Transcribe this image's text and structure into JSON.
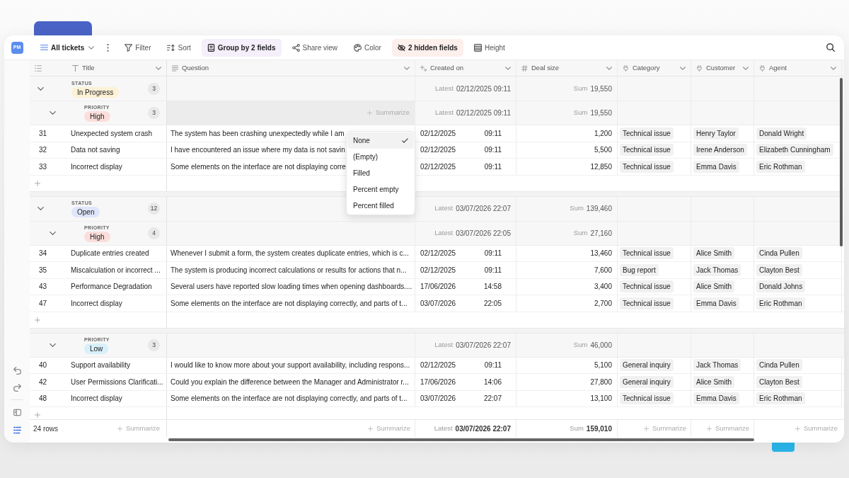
{
  "sidebar": {
    "badge": "PM",
    "tools": [
      {
        "kind": "undo",
        "selected": false
      },
      {
        "kind": "redo",
        "selected": false
      },
      {
        "kind": "panel",
        "selected": false
      },
      {
        "kind": "list",
        "selected": true
      }
    ]
  },
  "toolbar": {
    "view": "All tickets",
    "buttons": [
      {
        "kind": "filter",
        "label": "Filter",
        "active": false
      },
      {
        "kind": "sort",
        "label": "Sort",
        "active": false
      },
      {
        "kind": "group",
        "label": "Group by 2 fields",
        "active": true,
        "color": "#f4effb"
      },
      {
        "kind": "share",
        "label": "Share view",
        "active": false
      },
      {
        "kind": "color",
        "label": "Color",
        "active": false
      },
      {
        "kind": "hidden",
        "label": "2 hidden fields",
        "active": true,
        "color": "#fcefec"
      },
      {
        "kind": "height",
        "label": "Height",
        "active": false
      }
    ]
  },
  "table": {
    "columns": [
      {
        "kind": "text",
        "label": "Title"
      },
      {
        "kind": "long_text",
        "label": "Question"
      },
      {
        "kind": "created",
        "label": "Created on"
      },
      {
        "kind": "number",
        "label": "Deal size"
      },
      {
        "kind": "link",
        "label": "Category"
      },
      {
        "kind": "link",
        "label": "Customer"
      },
      {
        "kind": "link",
        "label": "Agent"
      }
    ],
    "groups": [
      {
        "field": "STATUS",
        "value": "In Progress",
        "color": "#fdf1d6",
        "count": "3",
        "expanded": true,
        "latest": {
          "label": "Latest",
          "value": "02/12/2025 09:11"
        },
        "sum": {
          "label": "Sum",
          "value": "19,550"
        },
        "children": [
          {
            "field": "PRIORITY",
            "value": "High",
            "color": "#fbdedb",
            "count": "3",
            "expanded": true,
            "summarize": {
              "label": "Summarize",
              "hovered": true,
              "menu": [
                {
                  "label": "None",
                  "selected": true
                },
                {
                  "label": "(Empty)",
                  "selected": false
                },
                {
                  "label": "Filled",
                  "selected": false
                },
                {
                  "label": "Percent empty",
                  "selected": false
                },
                {
                  "label": "Percent filled",
                  "selected": false
                }
              ]
            },
            "latest": {
              "label": "Latest",
              "value": "02/12/2025 09:11"
            },
            "sum": {
              "label": "Sum",
              "value": "19,550"
            },
            "rows": [
              {
                "id": "31",
                "title": "Unexpected system crash",
                "question": "The system has been crashing unexpectedly while I am",
                "date": "02/12/2025",
                "time": "09:11",
                "deal_size": "1,200",
                "category": "Technical issue",
                "customer": "Henry Taylor",
                "agent": "Donald Wright"
              },
              {
                "id": "32",
                "title": "Data not saving",
                "question": "I have encountered an issue where my data is not savin",
                "date": "02/12/2025",
                "time": "09:11",
                "deal_size": "5,500",
                "category": "Technical issue",
                "customer": "Irene Anderson",
                "agent": "Elizabeth Cunningham"
              },
              {
                "id": "33",
                "title": "Incorrect display",
                "question": "Some elements on the interface are not displaying corre",
                "date": "02/12/2025",
                "time": "09:11",
                "deal_size": "12,850",
                "category": "Technical issue",
                "customer": "Emma Davis",
                "agent": "Eric Rothman"
              }
            ]
          }
        ]
      },
      {
        "field": "STATUS",
        "value": "Open",
        "color": "#dfe6fb",
        "count": "12",
        "expanded": true,
        "latest": {
          "label": "Latest",
          "value": "03/07/2026 22:07"
        },
        "sum": {
          "label": "Sum",
          "value": "139,460"
        },
        "children": [
          {
            "field": "PRIORITY",
            "value": "High",
            "color": "#fbdedb",
            "count": "4",
            "expanded": true,
            "latest": {
              "label": "Latest",
              "value": "03/07/2026 22:05"
            },
            "sum": {
              "label": "Sum",
              "value": "27,160"
            },
            "rows": [
              {
                "id": "34",
                "title": "Duplicate entries created",
                "question": "Whenever I submit a form, the system creates duplicate entries, which is c...",
                "date": "02/12/2025",
                "time": "09:11",
                "deal_size": "13,460",
                "category": "Technical issue",
                "customer": "Alice Smith",
                "agent": "Cinda Pullen"
              },
              {
                "id": "35",
                "title": "Miscalculation or incorrect ...",
                "question": "The system is producing incorrect calculations or results for actions that n...",
                "date": "02/12/2025",
                "time": "09:11",
                "deal_size": "7,600",
                "category": "Bug report",
                "customer": "Jack Thomas",
                "agent": "Clayton Best"
              },
              {
                "id": "43",
                "title": "Performance Degradation",
                "question": "Several users have reported slow loading times when opening dashboards....",
                "date": "17/06/2026",
                "time": "14:58",
                "deal_size": "3,400",
                "category": "Technical issue",
                "customer": "Alice Smith",
                "agent": "Donald Johns"
              },
              {
                "id": "47",
                "title": "Incorrect display",
                "question": "Some elements on the interface are not displaying correctly, and parts of t...",
                "date": "03/07/2026",
                "time": "22:05",
                "deal_size": "2,700",
                "category": "Technical issue",
                "customer": "Emma Davis",
                "agent": "Eric Rothman"
              }
            ]
          },
          {
            "field": "PRIORITY",
            "value": "Low",
            "color": "#d8f0fa",
            "count": "3",
            "expanded": true,
            "latest": {
              "label": "Latest",
              "value": "03/07/2026 22:07"
            },
            "sum": {
              "label": "Sum",
              "value": "46,000"
            },
            "rows": [
              {
                "id": "40",
                "title": "Support availability",
                "question": "I would like to know more about your support availability, including respons...",
                "date": "02/12/2025",
                "time": "09:11",
                "deal_size": "5,100",
                "category": "General inquiry",
                "customer": "Jack Thomas",
                "agent": "Cinda Pullen"
              },
              {
                "id": "42",
                "title": "User Permissions Clarificati...",
                "question": "Could you explain the difference between the Manager and Administrator r...",
                "date": "17/06/2026",
                "time": "14:06",
                "deal_size": "27,800",
                "category": "General inquiry",
                "customer": "Alice Smith",
                "agent": "Clayton Best"
              },
              {
                "id": "48",
                "title": "Incorrect display",
                "question": "Some elements on the interface are not displaying correctly, and parts of t...",
                "date": "03/07/2026",
                "time": "22:07",
                "deal_size": "13,100",
                "category": "Technical issue",
                "customer": "Emma Davis",
                "agent": "Eric Rothman"
              }
            ]
          }
        ]
      }
    ],
    "footer": {
      "count": "24 rows",
      "cells": [
        {
          "kind": "summarize",
          "label": "Summarize"
        },
        {
          "kind": "summarize",
          "label": "Summarize"
        },
        {
          "kind": "aggregate",
          "label": "Latest",
          "value": "03/07/2026 22:07"
        },
        {
          "kind": "aggregate",
          "label": "Sum",
          "value": "159,010"
        },
        {
          "kind": "summarize",
          "label": "Summarize"
        },
        {
          "kind": "summarize",
          "label": "Summarize"
        },
        {
          "kind": "summarize",
          "label": "Summarize"
        }
      ]
    }
  }
}
